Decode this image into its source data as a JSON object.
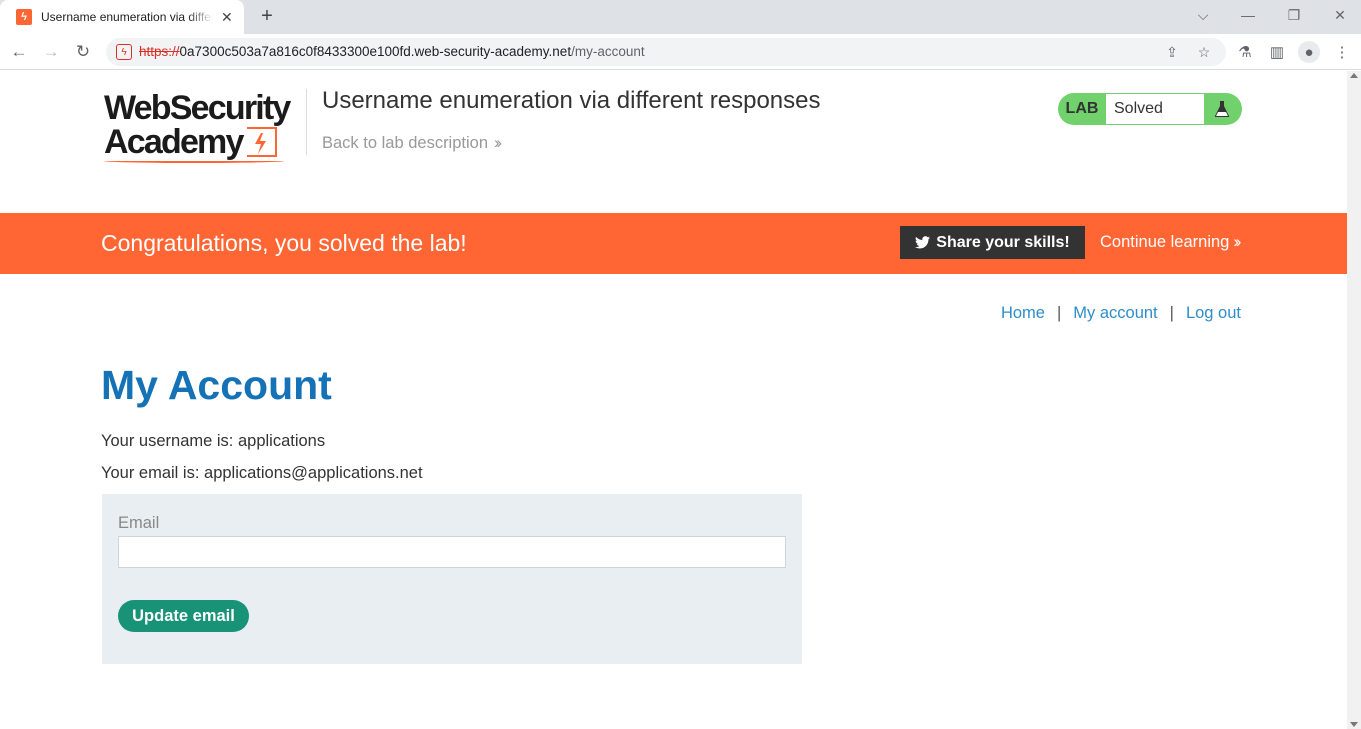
{
  "browser": {
    "tab_title": "Username enumeration via different responses",
    "url_scheme": "https://",
    "url_host": "0a7300c503a7a816c0f8433300e100fd.web-security-academy.net",
    "url_path": "/my-account"
  },
  "header": {
    "logo_line1": "WebSecurity",
    "logo_line2": "Academy",
    "lab_title": "Username enumeration via different responses",
    "back_link": "Back to lab description",
    "lab_badge": "LAB",
    "lab_status": "Solved"
  },
  "banner": {
    "message": "Congratulations, you solved the lab!",
    "share_button": "Share your skills!",
    "continue_link": "Continue learning"
  },
  "nav": {
    "home": "Home",
    "my_account": "My account",
    "log_out": "Log out",
    "separator": "|"
  },
  "account": {
    "title": "My Account",
    "username_line": "Your username is: applications",
    "email_line": "Your email is: applications@applications.net",
    "email_label": "Email",
    "email_value": "",
    "update_button": "Update email"
  },
  "colors": {
    "accent_orange": "#ff6633",
    "solved_green": "#70d16d",
    "link_blue": "#2e8ec9",
    "title_blue": "#1572b6",
    "button_green": "#189377"
  }
}
